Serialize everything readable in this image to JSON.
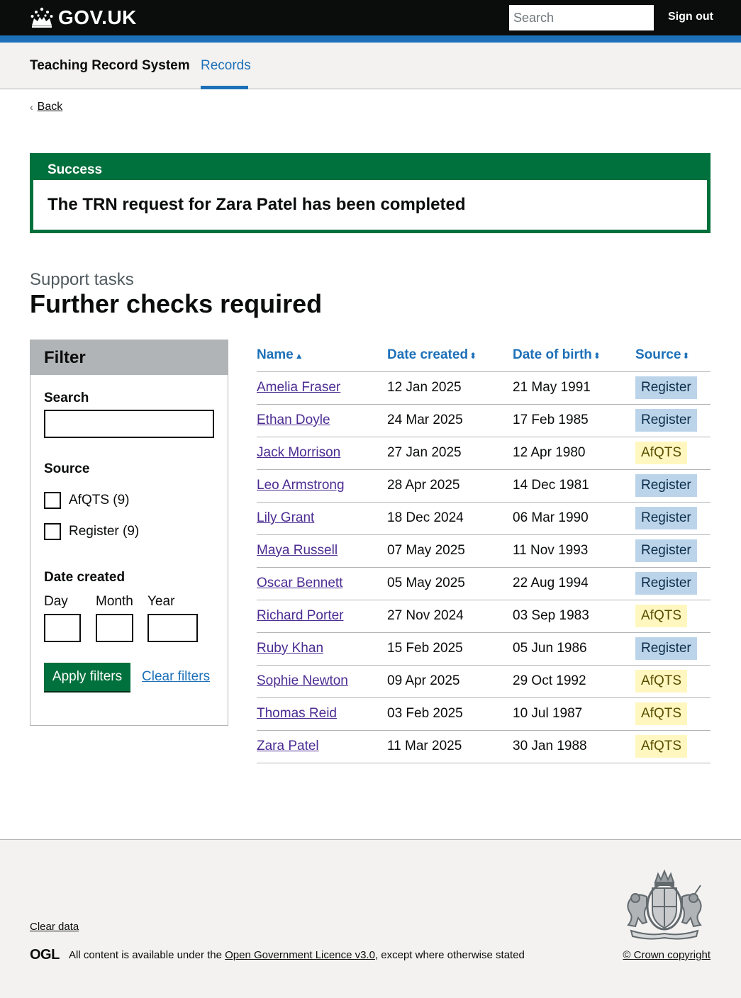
{
  "header": {
    "logo_text": "GOV.UK",
    "search_placeholder": "Search",
    "sign_out": "Sign out"
  },
  "service_nav": {
    "service_name": "Teaching Record System",
    "nav_item": "Records"
  },
  "back_link": "Back",
  "banner": {
    "title": "Success",
    "message": "The TRN request for Zara Patel has been completed"
  },
  "caption": "Support tasks",
  "page_title": "Further checks required",
  "filter": {
    "heading": "Filter",
    "search_label": "Search",
    "search_value": "",
    "source_label": "Source",
    "options": [
      {
        "label": "AfQTS (9)",
        "checked": false
      },
      {
        "label": "Register (9)",
        "checked": false
      }
    ],
    "date_label": "Date created",
    "day_label": "Day",
    "month_label": "Month",
    "year_label": "Year",
    "apply": "Apply filters",
    "clear": "Clear filters"
  },
  "table": {
    "headers": [
      {
        "label": "Name",
        "sort": "▲"
      },
      {
        "label": "Date created",
        "sort": "⬍"
      },
      {
        "label": "Date of birth",
        "sort": "⬍"
      },
      {
        "label": "Source",
        "sort": "⬍"
      }
    ],
    "rows": [
      {
        "name": "Amelia Fraser",
        "created": "12 Jan 2025",
        "dob": "21 May 1991",
        "source": "Register"
      },
      {
        "name": "Ethan Doyle",
        "created": "24 Mar 2025",
        "dob": "17 Feb 1985",
        "source": "Register"
      },
      {
        "name": "Jack Morrison",
        "created": "27 Jan 2025",
        "dob": "12 Apr 1980",
        "source": "AfQTS"
      },
      {
        "name": "Leo Armstrong",
        "created": "28 Apr 2025",
        "dob": "14 Dec 1981",
        "source": "Register"
      },
      {
        "name": "Lily Grant",
        "created": "18 Dec 2024",
        "dob": "06 Mar 1990",
        "source": "Register"
      },
      {
        "name": "Maya Russell",
        "created": "07 May 2025",
        "dob": "11 Nov 1993",
        "source": "Register"
      },
      {
        "name": "Oscar Bennett",
        "created": "05 May 2025",
        "dob": "22 Aug 1994",
        "source": "Register"
      },
      {
        "name": "Richard Porter",
        "created": "27 Nov 2024",
        "dob": "03 Sep 1983",
        "source": "AfQTS"
      },
      {
        "name": "Ruby Khan",
        "created": "15 Feb 2025",
        "dob": "05 Jun 1986",
        "source": "Register"
      },
      {
        "name": "Sophie Newton",
        "created": "09 Apr 2025",
        "dob": "29 Oct 1992",
        "source": "AfQTS"
      },
      {
        "name": "Thomas Reid",
        "created": "03 Feb 2025",
        "dob": "10 Jul 1987",
        "source": "AfQTS"
      },
      {
        "name": "Zara Patel",
        "created": "11 Mar 2025",
        "dob": "30 Jan 1988",
        "source": "AfQTS"
      }
    ]
  },
  "footer": {
    "clear_data": "Clear data",
    "ogl": "OGL",
    "licence_prefix": "All content is available under the ",
    "licence_link": "Open Government Licence v3.0",
    "licence_suffix": ", except where otherwise stated",
    "copyright": "© Crown copyright"
  },
  "colors": {
    "header_bg": "#0b0c0c",
    "brand_blue": "#1d70b8",
    "success_green": "#00703c",
    "register_tag_bg": "#bbd4ea",
    "afqts_tag_bg": "#fff7bf",
    "visited_link": "#4c2c92"
  },
  "icons": [
    "gov-uk-crown-icon",
    "back-chevron-icon",
    "sort-icon",
    "royal-crest-icon"
  ]
}
